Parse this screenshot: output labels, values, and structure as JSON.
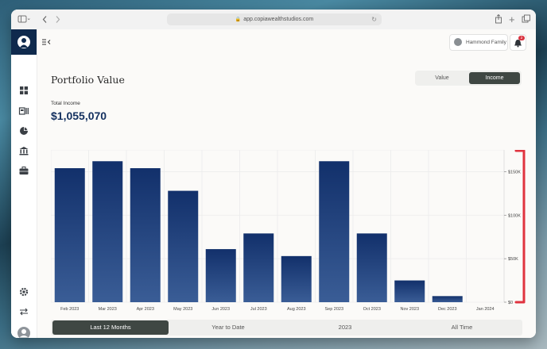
{
  "browser": {
    "url": "app.copiawealthstudios.com"
  },
  "header": {
    "family_label": "Hammond Family",
    "notifications_count": "2"
  },
  "page": {
    "title": "Portfolio Value",
    "toggle": [
      {
        "label": "Value",
        "active": false
      },
      {
        "label": "Income",
        "active": true
      }
    ],
    "total_label": "Total Income",
    "total_value": "$1,055,070"
  },
  "chart_data": {
    "type": "bar",
    "categories": [
      "Feb 2023",
      "Mar 2023",
      "Apr 2023",
      "May 2023",
      "Jun 2023",
      "Jul 2023",
      "Aug 2023",
      "Sep 2023",
      "Oct 2023",
      "Nov 2023",
      "Dec 2023",
      "Jan 2024"
    ],
    "values": [
      154000,
      162000,
      154000,
      128000,
      61000,
      79000,
      53000,
      162000,
      79000,
      25000,
      7000,
      0
    ],
    "y_ticks": [
      "$0",
      "$50K",
      "$100K",
      "$150K"
    ],
    "y_tick_values": [
      0,
      50000,
      100000,
      150000
    ],
    "ylim": [
      0,
      175000
    ],
    "y_axis_side": "right",
    "grid": true,
    "bar_color_top": "#12306b",
    "bar_color_bottom": "#3a5d96",
    "highlight_color": "#e0333f"
  },
  "range_tabs": [
    {
      "label": "Last 12 Months",
      "active": true
    },
    {
      "label": "Year to Date",
      "active": false
    },
    {
      "label": "2023",
      "active": false
    },
    {
      "label": "All Time",
      "active": false
    }
  ],
  "sidebar": {
    "items": [
      {
        "icon": "dashboard-icon"
      },
      {
        "icon": "accounts-icon"
      },
      {
        "icon": "pie-chart-icon"
      },
      {
        "icon": "bank-icon"
      },
      {
        "icon": "briefcase-icon"
      }
    ],
    "bottom": [
      {
        "icon": "settings-icon"
      },
      {
        "icon": "switch-icon"
      },
      {
        "icon": "user-avatar-icon"
      }
    ]
  }
}
